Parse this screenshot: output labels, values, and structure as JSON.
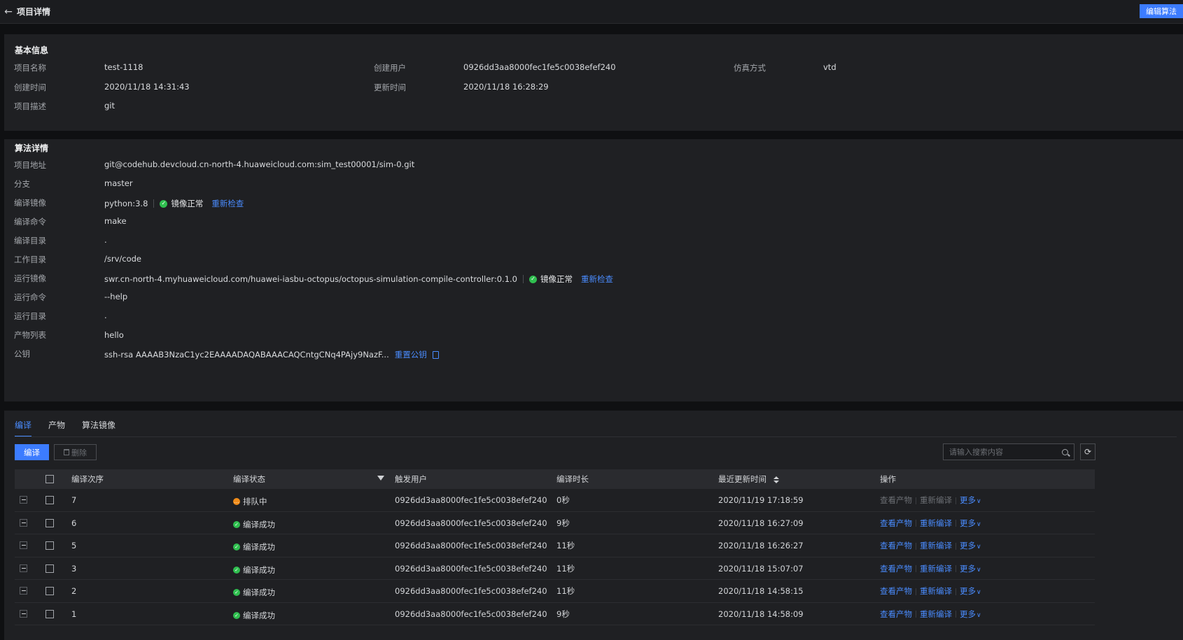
{
  "header": {
    "title": "项目详情",
    "edit_button": "编辑算法"
  },
  "basic": {
    "section_title": "基本信息",
    "fields": [
      {
        "label": "项目名称",
        "value": "test-1118"
      },
      {
        "label": "创建用户",
        "value": "0926dd3aa8000fec1fe5c0038efef240"
      },
      {
        "label": "仿真方式",
        "value": "vtd"
      },
      {
        "label": "创建时间",
        "value": "2020/11/18 14:31:43"
      },
      {
        "label": "更新时间",
        "value": "2020/11/18 16:28:29"
      },
      {
        "label": "项目描述",
        "value": "git"
      }
    ]
  },
  "algo": {
    "section_title": "算法详情",
    "fields": [
      {
        "label": "项目地址",
        "value": "git@codehub.devcloud.cn-north-4.huaweicloud.com:sim_test00001/sim-0.git"
      },
      {
        "label": "分支",
        "value": "master"
      },
      {
        "label": "编译镜像",
        "value": "python:3.8",
        "status": "镜像正常",
        "action": "重新检查"
      },
      {
        "label": "编译命令",
        "value": "make"
      },
      {
        "label": "编译目录",
        "value": "."
      },
      {
        "label": "工作目录",
        "value": "/srv/code"
      },
      {
        "label": "运行镜像",
        "value": "swr.cn-north-4.myhuaweicloud.com/huawei-iasbu-octopus/octopus-simulation-compile-controller:0.1.0",
        "status": "镜像正常",
        "action": "重新检查"
      },
      {
        "label": "运行命令",
        "value": "--help"
      },
      {
        "label": "运行目录",
        "value": "."
      },
      {
        "label": "产物列表",
        "value": "hello"
      },
      {
        "label": "公钥",
        "value": "ssh-rsa AAAAB3NzaC1yc2EAAAADAQABAAACAQCntgCNq4PAjy9NazF...",
        "action": "重置公钥"
      }
    ]
  },
  "tabs": [
    "编译",
    "产物",
    "算法镜像"
  ],
  "toolbar": {
    "compile_button": "编译",
    "delete_button": "删除",
    "search_placeholder": "请输入搜索内容"
  },
  "table": {
    "columns": [
      "编译次序",
      "编译状态",
      "触发用户",
      "编译时长",
      "最近更新时间",
      "操作"
    ],
    "rows": [
      {
        "order": "7",
        "status": "排队中",
        "status_type": "queue",
        "user": "0926dd3aa8000fec1fe5c0038efef240",
        "duration": "0秒",
        "updated": "2020/11/19 17:18:59",
        "enabled": false
      },
      {
        "order": "6",
        "status": "编译成功",
        "status_type": "ok",
        "user": "0926dd3aa8000fec1fe5c0038efef240",
        "duration": "9秒",
        "updated": "2020/11/18 16:27:09",
        "enabled": true
      },
      {
        "order": "5",
        "status": "编译成功",
        "status_type": "ok",
        "user": "0926dd3aa8000fec1fe5c0038efef240",
        "duration": "11秒",
        "updated": "2020/11/18 16:26:27",
        "enabled": true
      },
      {
        "order": "3",
        "status": "编译成功",
        "status_type": "ok",
        "user": "0926dd3aa8000fec1fe5c0038efef240",
        "duration": "11秒",
        "updated": "2020/11/18 15:07:07",
        "enabled": true
      },
      {
        "order": "2",
        "status": "编译成功",
        "status_type": "ok",
        "user": "0926dd3aa8000fec1fe5c0038efef240",
        "duration": "11秒",
        "updated": "2020/11/18 14:58:15",
        "enabled": true
      },
      {
        "order": "1",
        "status": "编译成功",
        "status_type": "ok",
        "user": "0926dd3aa8000fec1fe5c0038efef240",
        "duration": "9秒",
        "updated": "2020/11/18 14:58:09",
        "enabled": true
      }
    ],
    "actions": {
      "view": "查看产物",
      "recompile": "重新编译",
      "more": "更多"
    }
  }
}
